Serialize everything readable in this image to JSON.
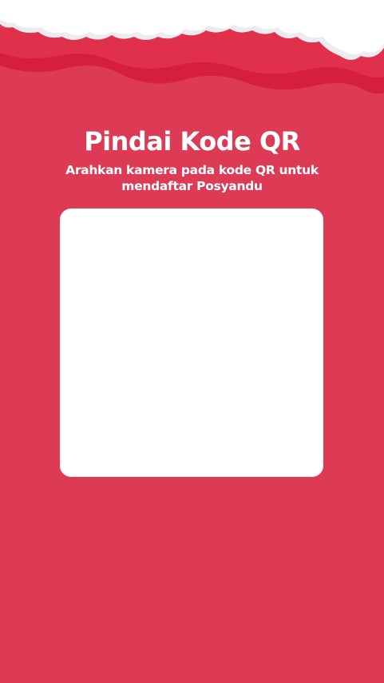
{
  "screen": {
    "title": "Pindai Kode QR",
    "subtitle_line1": "Arahkan kamera pada kode QR untuk",
    "subtitle_line2": "mendaftar Posyandu"
  },
  "colors": {
    "background": "#dd3a55",
    "wave_dark": "#d61f3e",
    "wave_mid": "#e23a55",
    "cloud": "#ffffff",
    "cloud_shadow": "#ececf0",
    "scanner_frame": "#ffffff"
  },
  "icons": {
    "header_decoration": "cloud-wave-decoration"
  }
}
